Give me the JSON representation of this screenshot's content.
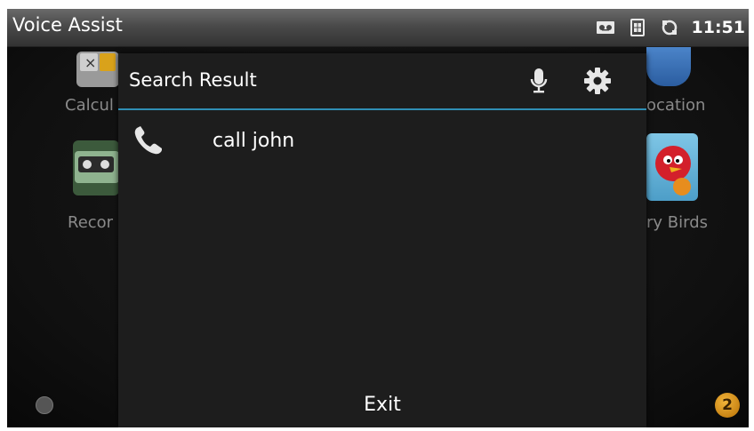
{
  "statusbar": {
    "app_title": "Voice Assist",
    "time": "11:51",
    "icons": [
      "voicemail-icon",
      "sim-card-icon",
      "sync-icon"
    ]
  },
  "launcher": {
    "labels": {
      "left_top": "Calcul",
      "left_mid": "Recor",
      "right_top": "ocation",
      "right_mid": "ry Birds"
    },
    "notification_count": "2"
  },
  "dialog": {
    "title": "Search Result",
    "results": [
      {
        "icon": "phone-icon",
        "text": "call john"
      }
    ],
    "exit_label": "Exit",
    "accent_color": "#2f8fb5"
  }
}
